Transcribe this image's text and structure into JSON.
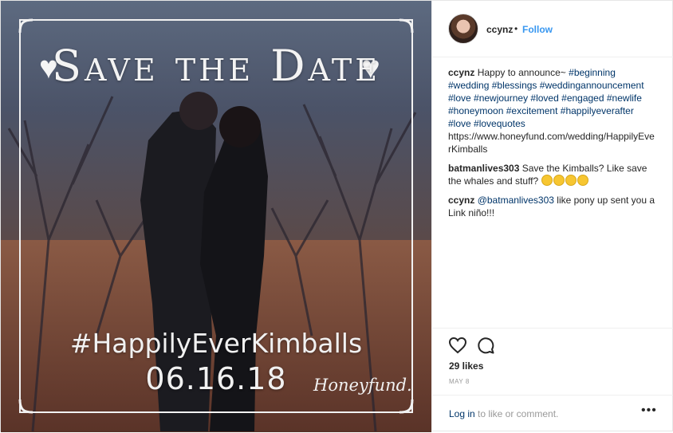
{
  "photo": {
    "title": "Save the Date",
    "heart": "♥",
    "hashtag": "#HappilyEverKimballs",
    "date": "06.16.18",
    "brand": "Honeyfund."
  },
  "header": {
    "username": "ccynz",
    "separator": "•",
    "follow": "Follow"
  },
  "caption": {
    "author": "ccynz",
    "text": "Happy to announce~",
    "tags": [
      "#beginning",
      "#wedding",
      "#blessings",
      "#weddingannouncement",
      "#love",
      "#newjourney",
      "#loved",
      "#engaged",
      "#newlife",
      "#honeymoon",
      "#excitement",
      "#happilyeverafter",
      "#love",
      "#lovequotes"
    ],
    "link": "https://www.honeyfund.com/wedding/HappilyEverKimballs"
  },
  "comments": [
    {
      "author": "batmanlives303",
      "text": "Save the Kimballs? Like save the whales and stuff?",
      "emoji_icons": [
        "thinking-emoji",
        "grinning-emoji",
        "smiling-emoji",
        "laughing-emoji"
      ]
    },
    {
      "author": "ccynz",
      "mention": "@batmanlives303",
      "text": "like pony up sent you a Link niño!!!"
    }
  ],
  "actions": {
    "like_icon": "heart-outline-icon",
    "comment_icon": "speech-bubble-icon",
    "likes": "29 likes",
    "time": "MAY 8"
  },
  "login": {
    "login_link": "Log in",
    "rest": "to like or comment.",
    "more": "•••"
  },
  "colors": {
    "accent": "#3897f0",
    "link": "#003569",
    "muted": "#999999"
  }
}
